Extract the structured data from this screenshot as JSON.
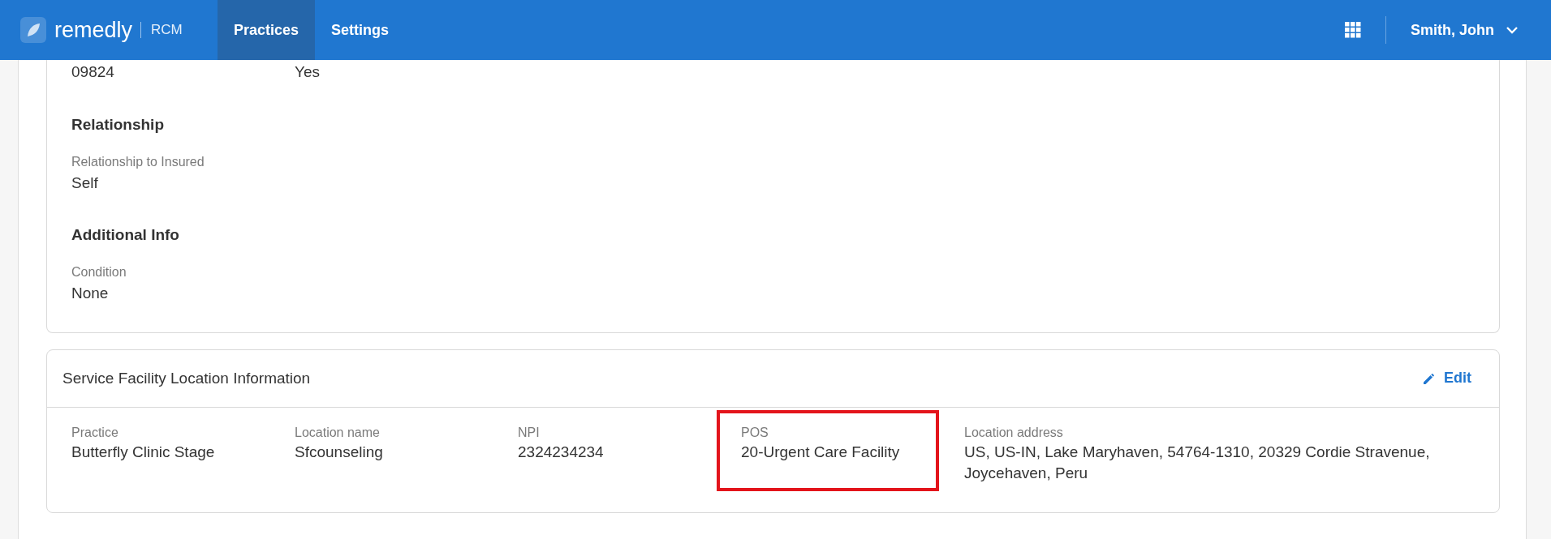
{
  "header": {
    "brand": "remedly",
    "product": "RCM",
    "nav": [
      {
        "label": "Practices",
        "selected": true
      },
      {
        "label": "Settings",
        "selected": false
      }
    ],
    "user": "Smith, John"
  },
  "top_card": {
    "cut_values": [
      "09824",
      "Yes"
    ],
    "sections": [
      {
        "title": "Relationship",
        "fields": [
          {
            "label": "Relationship to Insured",
            "value": "Self"
          }
        ]
      },
      {
        "title": "Additional Info",
        "fields": [
          {
            "label": "Condition",
            "value": "None"
          }
        ]
      }
    ]
  },
  "facility_card": {
    "title": "Service Facility Location Information",
    "edit": "Edit",
    "fields": [
      {
        "label": "Practice",
        "value": "Butterfly Clinic Stage",
        "highlighted": false
      },
      {
        "label": "Location name",
        "value": "Sfcounseling",
        "highlighted": false
      },
      {
        "label": "NPI",
        "value": "2324234234",
        "highlighted": false
      },
      {
        "label": "POS",
        "value": "20-Urgent Care Facility",
        "highlighted": true
      },
      {
        "label": "Location address",
        "value": "US, US-IN, Lake Maryhaven, 54764-1310, 20329 Cordie Stravenue, Joycehaven, Peru",
        "highlighted": false
      }
    ]
  }
}
